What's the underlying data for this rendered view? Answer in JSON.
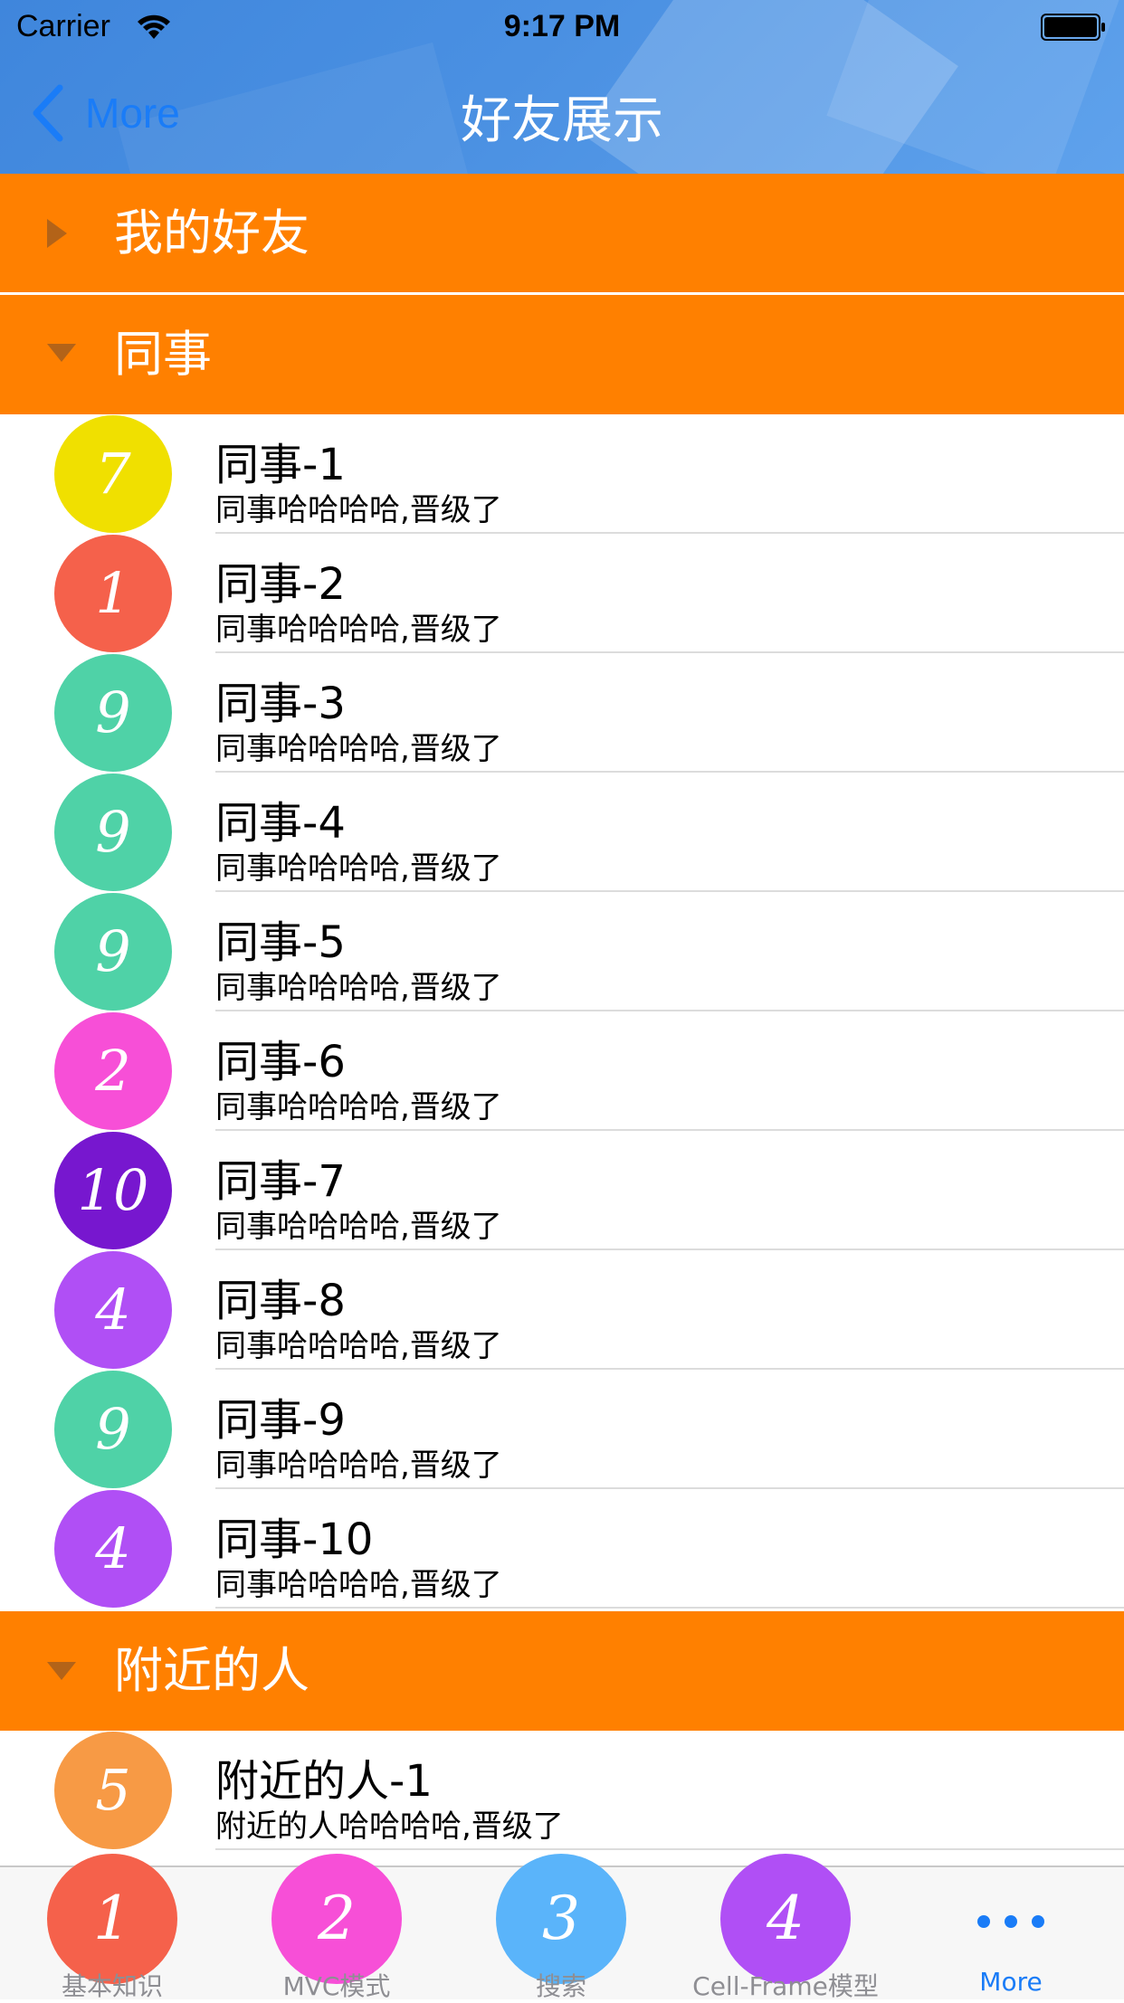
{
  "status_bar": {
    "carrier": "Carrier",
    "time": "9:17 PM"
  },
  "nav": {
    "back_label": "More",
    "title": "好友展示"
  },
  "sections": [
    {
      "title": "我的好友",
      "expanded": false
    },
    {
      "title": "同事",
      "expanded": true
    },
    {
      "title": "附近的人",
      "expanded": true
    }
  ],
  "colleagues": [
    {
      "avatar": "7",
      "color": "#f0e000",
      "name": "同事-1",
      "detail": "同事哈哈哈哈,晋级了"
    },
    {
      "avatar": "1",
      "color": "#f5614b",
      "name": "同事-2",
      "detail": "同事哈哈哈哈,晋级了"
    },
    {
      "avatar": "9",
      "color": "#4fd2a7",
      "name": "同事-3",
      "detail": "同事哈哈哈哈,晋级了"
    },
    {
      "avatar": "9",
      "color": "#4fd2a7",
      "name": "同事-4",
      "detail": "同事哈哈哈哈,晋级了"
    },
    {
      "avatar": "9",
      "color": "#4fd2a7",
      "name": "同事-5",
      "detail": "同事哈哈哈哈,晋级了"
    },
    {
      "avatar": "2",
      "color": "#f74fd7",
      "name": "同事-6",
      "detail": "同事哈哈哈哈,晋级了"
    },
    {
      "avatar": "10",
      "color": "#7717cf",
      "name": "同事-7",
      "detail": "同事哈哈哈哈,晋级了"
    },
    {
      "avatar": "4",
      "color": "#b04ff5",
      "name": "同事-8",
      "detail": "同事哈哈哈哈,晋级了"
    },
    {
      "avatar": "9",
      "color": "#4fd2a7",
      "name": "同事-9",
      "detail": "同事哈哈哈哈,晋级了"
    },
    {
      "avatar": "4",
      "color": "#b04ff5",
      "name": "同事-10",
      "detail": "同事哈哈哈哈,晋级了"
    }
  ],
  "nearby": [
    {
      "avatar": "5",
      "color": "#f79a45",
      "name": "附近的人-1",
      "detail": "附近的人哈哈哈哈,晋级了"
    }
  ],
  "tabs": [
    {
      "icon": "1",
      "color": "#f5614b",
      "label": "基本知识"
    },
    {
      "icon": "2",
      "color": "#f74fd7",
      "label": "MVC模式"
    },
    {
      "icon": "3",
      "color": "#5ab4fa",
      "label": "搜索"
    },
    {
      "icon": "4",
      "color": "#b04ff5",
      "label": "Cell-Frame模型"
    },
    {
      "icon": "more-dots-icon",
      "label": "More",
      "active": true
    }
  ],
  "colors": {
    "accent": "#1a7cf7",
    "section_header": "#ff8000",
    "nav_bar": "#4a90e2"
  }
}
